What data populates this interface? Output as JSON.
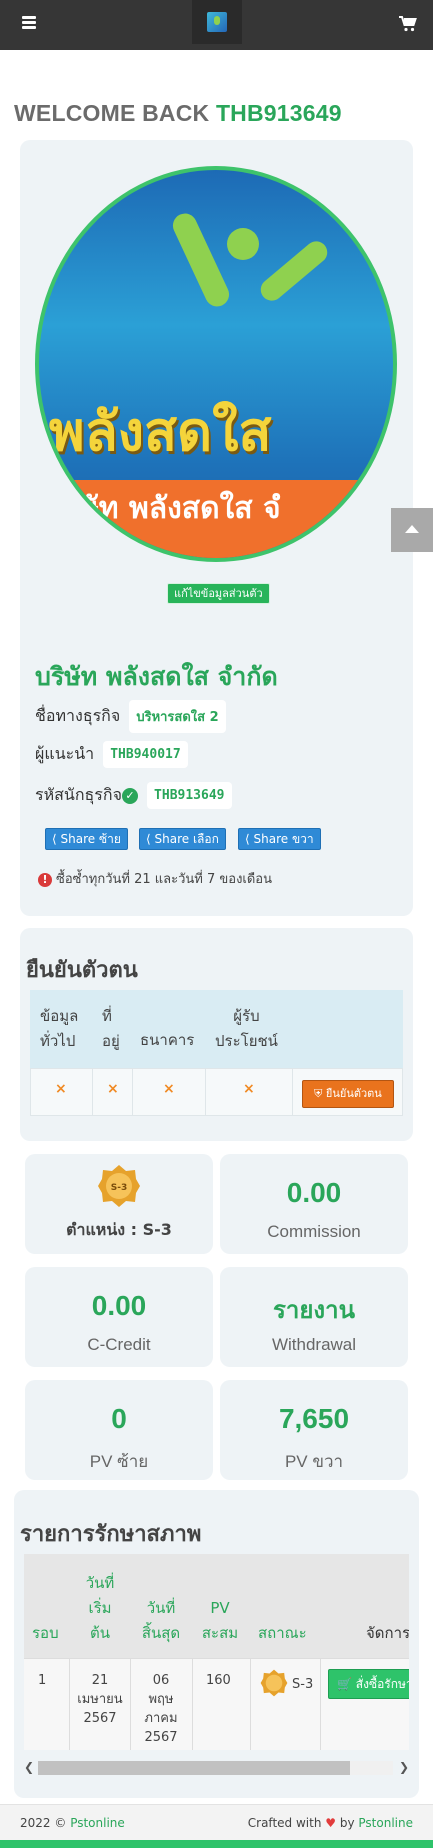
{
  "colors": {
    "accent": "#2aa65a",
    "topbar": "#363636",
    "card": "#eef3f6",
    "orange": "#e9731d",
    "share": "#2f8ad6"
  },
  "header": {
    "menu_icon": "hamburger-icon",
    "cart_icon": "shopping-cart-icon"
  },
  "welcome": {
    "prefix": "WELCOME BACK",
    "user_id": "THB913649"
  },
  "profile": {
    "avatar_text": "พลังสดใส",
    "avatar_band_text": "ษัท พลังสดใส จํ",
    "edit_label": "แก้ไขข้อมูลส่วนตัว",
    "company_name": "บริษัท พลังสดใส จํากัด",
    "business_name_label": "ชื่อทางธุรกิจ",
    "business_name": "บริหารสดใส 2",
    "referrer_label": "ผู้แนะนำ",
    "referrer": "THB940017",
    "member_code_label": "รหัสนักธุรกิจ",
    "member_code": "THB913649",
    "share_left": "Share ซ้าย",
    "share_choose": "Share เลือก",
    "share_right": "Share ขวา",
    "note": "ซื้อซ้ำทุกวันที่ 21 และวันที่ 7 ของเดือน"
  },
  "verify": {
    "title": "ยืนยันตัวตน",
    "headers": [
      "ข้อมูล\nทั่วไป",
      "ที่\nอยู่",
      "ธนาคาร",
      "ผู้รับ\nประโยชน์"
    ],
    "status_marks": [
      "×",
      "×",
      "×",
      "×"
    ],
    "button": "ยืนยันตัวตน"
  },
  "stats": {
    "rank_label": "ตำแหน่ง : S-3",
    "rank_badge_text": "S-3",
    "commission_value": "0.00",
    "commission_label": "Commission",
    "ccredit_value": "0.00",
    "ccredit_label": "C-Credit",
    "report_value": "รายงาน",
    "withdrawal_label": "Withdrawal",
    "pv_left_value": "0",
    "pv_left_label": "PV ซ้าย",
    "pv_right_value": "7,650",
    "pv_right_label": "PV ขวา"
  },
  "maintenance": {
    "title": "รายการรักษาสภาพ",
    "headers": {
      "round": "รอบ",
      "start": "วันที่\nเริ่ม\nต้น",
      "end": "วันที่\nสิ้นสุด",
      "pv": "PV\nสะสม",
      "status": "สถาณะ",
      "manage": "จัดการ"
    },
    "rows": [
      {
        "round": "1",
        "start": "21\nเมษายน\n2567",
        "end": "06\nพฤษ\nภาคม\n2567",
        "pv": "160",
        "status": "S-3",
        "action": "สั่งซื้อรักษา"
      }
    ]
  },
  "footer": {
    "year": "2022 ©",
    "brand": "Pstonline",
    "crafted": "Crafted with",
    "by": "by",
    "brand2": "Pstonline"
  }
}
